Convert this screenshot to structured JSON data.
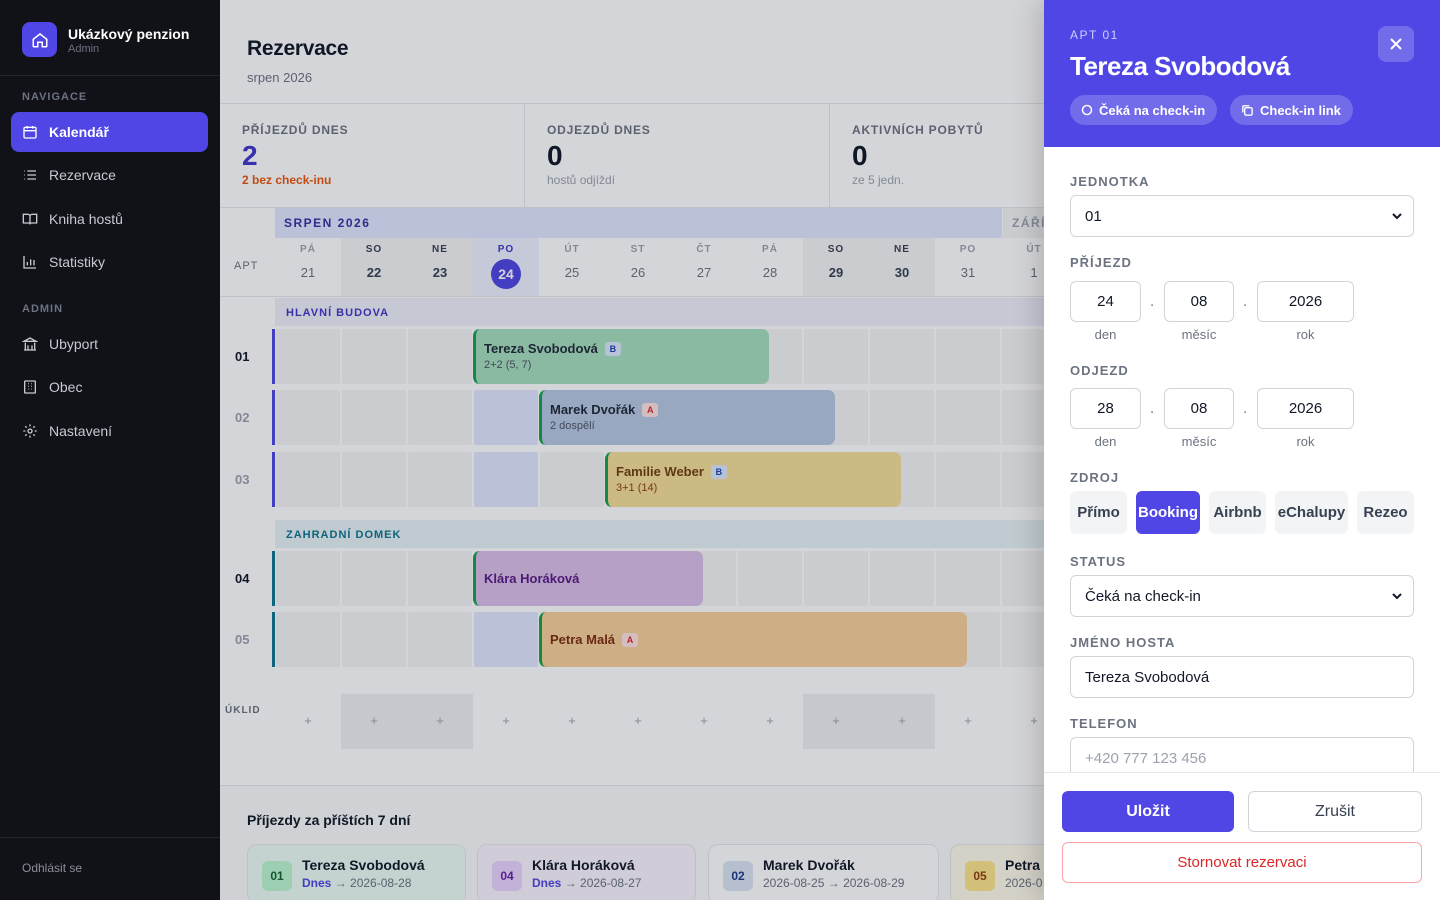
{
  "brand": {
    "name": "Ukázkový penzion",
    "role": "Admin"
  },
  "nav": {
    "section_navigation": "NAVIGACE",
    "section_admin": "ADMIN",
    "items": [
      {
        "label": "Kalendář",
        "icon": "calendar-icon",
        "active": true
      },
      {
        "label": "Rezervace",
        "icon": "list-icon"
      },
      {
        "label": "Kniha hostů",
        "icon": "book-icon"
      },
      {
        "label": "Statistiky",
        "icon": "chart-icon"
      }
    ],
    "admin_items": [
      {
        "label": "Ubyport",
        "icon": "building-icon"
      },
      {
        "label": "Obec",
        "icon": "office-icon"
      },
      {
        "label": "Nastavení",
        "icon": "gear-icon"
      }
    ],
    "logout": "Odhlásit se"
  },
  "header": {
    "title": "Rezervace",
    "subtitle": "srpen 2026"
  },
  "stats": [
    {
      "label": "PŘÍJEZDŮ DNES",
      "value": "2",
      "note": "2 bez check-inu"
    },
    {
      "label": "ODJEZDŮ DNES",
      "value": "0",
      "note": "hostů odjíždí"
    },
    {
      "label": "AKTIVNÍCH POBYTŮ",
      "value": "0",
      "note": "ze 5 jedn."
    }
  ],
  "calendar": {
    "month": "SRPEN 2026",
    "next_month": "ZÁŘÍ",
    "apt_header": "APT",
    "days": [
      {
        "dn": "PÁ",
        "dd": "21"
      },
      {
        "dn": "SO",
        "dd": "22"
      },
      {
        "dn": "NE",
        "dd": "23"
      },
      {
        "dn": "PO",
        "dd": "24"
      },
      {
        "dn": "ÚT",
        "dd": "25"
      },
      {
        "dn": "ST",
        "dd": "26"
      },
      {
        "dn": "ČT",
        "dd": "27"
      },
      {
        "dn": "PÁ",
        "dd": "28"
      },
      {
        "dn": "SO",
        "dd": "29"
      },
      {
        "dn": "NE",
        "dd": "30"
      },
      {
        "dn": "PO",
        "dd": "31"
      },
      {
        "dn": "ÚT",
        "dd": "1"
      }
    ],
    "groups": [
      "HLAVNÍ BUDOVA",
      "ZAHRADNÍ DOMEK"
    ],
    "rows": [
      "01",
      "02",
      "03",
      "04",
      "05"
    ],
    "bookings": [
      {
        "name": "Tereza Svobodová",
        "src": "B",
        "detail": "2+2 (5, 7)"
      },
      {
        "name": "Marek Dvořák",
        "src": "A",
        "detail": "2 dospělí"
      },
      {
        "name": "Familie Weber",
        "src": "B",
        "detail": "3+1 (14)"
      },
      {
        "name": "Klára Horáková",
        "src": "",
        "detail": ""
      },
      {
        "name": "Petra Malá",
        "src": "A",
        "detail": ""
      }
    ],
    "cleanup_label": "ÚKLID",
    "cleanup_symbol": "+"
  },
  "arrivals": {
    "title": "Příjezdy za příštích 7 dní",
    "cards": [
      {
        "apt": "01",
        "name": "Tereza Svobodová",
        "today": "Dnes",
        "arrow": "→",
        "date_to": "2026-08-28"
      },
      {
        "apt": "04",
        "name": "Klára Horáková",
        "today": "Dnes",
        "arrow": "→",
        "date_to": "2026-08-27"
      },
      {
        "apt": "02",
        "name": "Marek Dvořák",
        "date_from": "2026-08-25",
        "arrow": "→",
        "date_to": "2026-08-29"
      },
      {
        "apt": "05",
        "name": "Petra",
        "date_from": "2026-0"
      }
    ]
  },
  "panel": {
    "apt": "APT 01",
    "guest_name": "Tereza Svobodová",
    "chip_status": "Čeká na check-in",
    "chip_link": "Check-in link",
    "unit_label": "JEDNOTKA",
    "unit_value": "01",
    "arrival_label": "PŘÍJEZD",
    "arrival": {
      "day": "24",
      "month": "08",
      "year": "2026"
    },
    "departure_label": "ODJEZD",
    "departure": {
      "day": "28",
      "month": "08",
      "year": "2026"
    },
    "date_caps": {
      "day": "den",
      "month": "měsíc",
      "year": "rok"
    },
    "date_sep": ".",
    "source_label": "ZDROJ",
    "sources": [
      "Přímo",
      "Booking",
      "Airbnb",
      "eChalupy",
      "Rezeo"
    ],
    "source_selected": "Booking",
    "status_label": "STATUS",
    "status_value": "Čeká na check-in",
    "guest_label": "JMÉNO HOSTA",
    "guest_value": "Tereza Svobodová",
    "phone_label": "TELEFON",
    "phone_placeholder": "+420 777 123 456",
    "save": "Uložit",
    "cancel": "Zrušit",
    "storno": "Stornovat rezervaci"
  },
  "colors": {
    "accent": "#4f46e5",
    "green": "#22c55e",
    "blue": "#5b8bd6",
    "yellow": "#eab308",
    "purple": "#a855f7",
    "orange": "#f59e0b"
  }
}
